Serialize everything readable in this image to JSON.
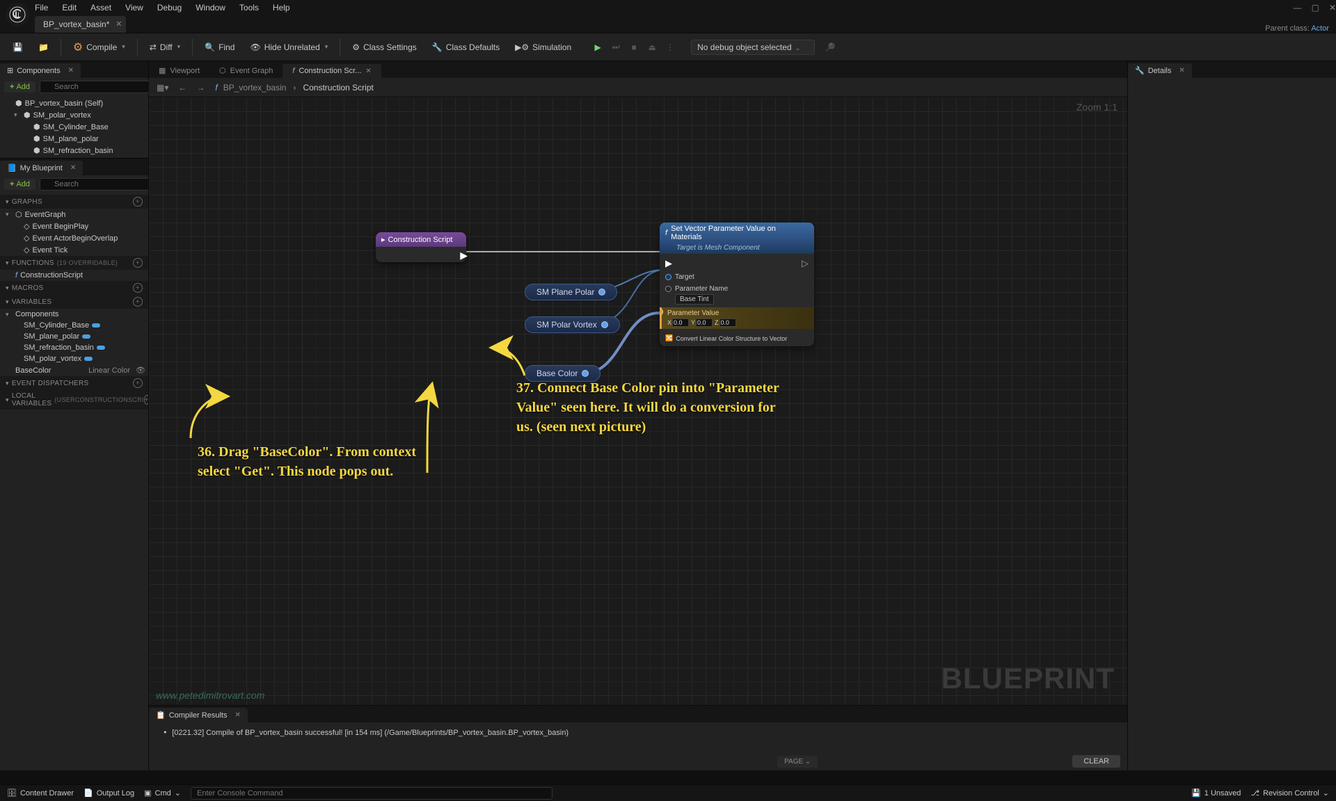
{
  "window": {
    "min": "—",
    "max": "▢",
    "close": "✕"
  },
  "menu": [
    "File",
    "Edit",
    "Asset",
    "View",
    "Debug",
    "Window",
    "Tools",
    "Help"
  ],
  "parent_class": {
    "label": "Parent class:",
    "value": "Actor"
  },
  "doc_tab": {
    "title": "BP_vortex_basin*"
  },
  "toolbar": {
    "compile": "Compile",
    "diff": "Diff",
    "find": "Find",
    "hide_unrelated": "Hide Unrelated",
    "class_settings": "Class Settings",
    "class_defaults": "Class Defaults",
    "simulation": "Simulation",
    "debug_select": "No debug object selected"
  },
  "components_panel": {
    "title": "Components",
    "add": "Add",
    "search_placeholder": "Search",
    "tree": [
      {
        "label": "BP_vortex_basin (Self)",
        "indent": 0,
        "icon": "actor"
      },
      {
        "label": "SM_polar_vortex",
        "indent": 1,
        "icon": "mesh",
        "disclosure": "▾"
      },
      {
        "label": "SM_Cylinder_Base",
        "indent": 2,
        "icon": "mesh"
      },
      {
        "label": "SM_plane_polar",
        "indent": 2,
        "icon": "mesh"
      },
      {
        "label": "SM_refraction_basin",
        "indent": 2,
        "icon": "mesh"
      }
    ]
  },
  "myblueprint_panel": {
    "title": "My Blueprint",
    "add": "Add",
    "search_placeholder": "Search",
    "sections": {
      "graphs": {
        "label": "Graphs",
        "items": [
          {
            "label": "EventGraph",
            "icon": "graph",
            "disclosure": "▾"
          },
          {
            "label": "Event BeginPlay",
            "icon": "event",
            "indent": 1
          },
          {
            "label": "Event ActorBeginOverlap",
            "icon": "event",
            "indent": 1
          },
          {
            "label": "Event Tick",
            "icon": "event",
            "indent": 1
          }
        ]
      },
      "functions": {
        "label": "Functions",
        "count": "(19 OVERRIDABLE)",
        "items": [
          {
            "label": "ConstructionScript",
            "icon": "func"
          }
        ]
      },
      "macros": {
        "label": "Macros",
        "items": []
      },
      "variables": {
        "label": "Variables",
        "items": [
          {
            "label": "Components",
            "disclosure": "▾",
            "header": true
          },
          {
            "label": "SM_Cylinder_Base",
            "pill": true,
            "indent": 1
          },
          {
            "label": "SM_plane_polar",
            "pill": true,
            "indent": 1
          },
          {
            "label": "SM_refraction_basin",
            "pill": true,
            "indent": 1
          },
          {
            "label": "SM_polar_vortex",
            "pill": true,
            "indent": 1
          },
          {
            "label": "BaseColor",
            "type": "Linear Color",
            "pill_color": "#4aa0e0",
            "indent": 0,
            "eye": true
          }
        ]
      },
      "event_dispatchers": {
        "label": "Event Dispatchers",
        "items": []
      },
      "local_variables": {
        "label": "Local Variables",
        "count": "(USERCONSTRUCTIONSCRI"
      }
    }
  },
  "editor_tabs": [
    {
      "label": "Viewport",
      "icon": "viewport"
    },
    {
      "label": "Event Graph",
      "icon": "graph"
    },
    {
      "label": "Construction Scr...",
      "icon": "func",
      "active": true
    }
  ],
  "breadcrumb": {
    "prev": "BP_vortex_basin",
    "current": "Construction Script"
  },
  "zoom": "Zoom 1:1",
  "nodes": {
    "construction": {
      "title": "Construction Script"
    },
    "plane": "SM Plane Polar",
    "vortex": "SM Polar Vortex",
    "basecolor": "Base Color",
    "setvec": {
      "title": "Set Vector Parameter Value on Materials",
      "subtitle": "Target is Mesh Component",
      "target": "Target",
      "param_name_label": "Parameter Name",
      "param_name_value": "Base Tint",
      "param_value_label": "Parameter Value",
      "x": "0.0",
      "y": "0.0",
      "z": "0.0",
      "xl": "X",
      "yl": "Y",
      "zl": "Z",
      "convert": "Convert Linear Color Structure to Vector"
    }
  },
  "watermark_bp": "BLUEPRINT",
  "watermark_site": "www.petedimitrovart.com",
  "annotations": {
    "a36": "36. Drag \"BaseColor\". From context select \"Get\". This node pops out.",
    "a37": "37. Connect Base Color pin into \"Parameter Value\" seen here. It will do a conversion for us. (seen next picture)"
  },
  "details_panel": {
    "title": "Details"
  },
  "compiler": {
    "title": "Compiler Results",
    "line": "[0221.32] Compile of BP_vortex_basin successful! [in 154 ms] (/Game/Blueprints/BP_vortex_basin.BP_vortex_basin)",
    "page": "PAGE",
    "clear": "CLEAR"
  },
  "statusbar": {
    "content_drawer": "Content Drawer",
    "output_log": "Output Log",
    "cmd": "Cmd",
    "console_placeholder": "Enter Console Command",
    "unsaved": "1 Unsaved",
    "revision": "Revision Control"
  }
}
